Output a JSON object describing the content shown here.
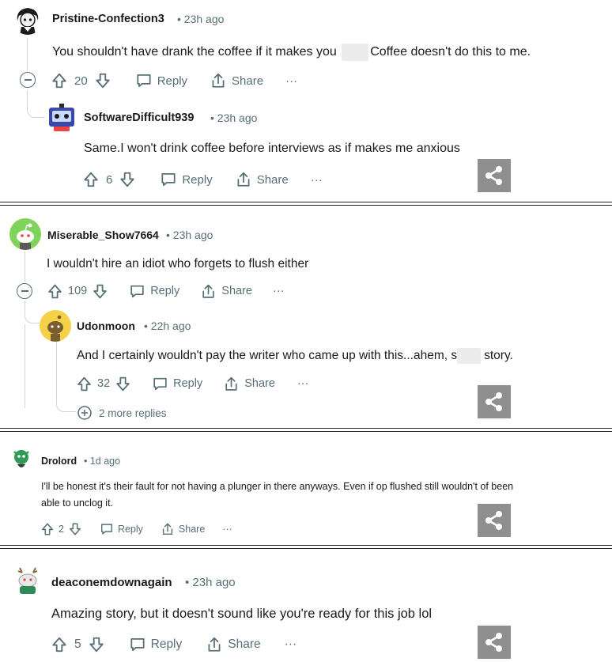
{
  "comments": [
    {
      "username": "Pristine-Confection3",
      "time": "• 23h ago",
      "text_before": "You shouldn't have drank the coffee if it makes you",
      "text_after": "Coffee doesn't do this to me.",
      "votes": "20",
      "reply": "Reply",
      "share": "Share",
      "more": "···",
      "avatar": "black-white-anime-avatar-icon",
      "reply_comment": {
        "username": "SoftwareDifficult939",
        "time": "• 23h ago",
        "text": "Same.I won't drink coffee before interviews as if makes me anxious",
        "votes": "6",
        "reply": "Reply",
        "share": "Share",
        "more": "···",
        "avatar": "robot-avatar-icon"
      }
    },
    {
      "username": "Miserable_Show7664",
      "time": "• 23h ago",
      "text": "I wouldn't hire an idiot who forgets to flush either",
      "votes": "109",
      "reply": "Reply",
      "share": "Share",
      "more": "···",
      "avatar": "green-snoo-avatar-icon",
      "reply_comment": {
        "username": "Udonmoon",
        "time": "• 22h ago",
        "text_before": "And I certainly wouldn't pay the writer who came up with this...ahem, s",
        "text_after": "story.",
        "votes": "32",
        "reply": "Reply",
        "share": "Share",
        "more": "···",
        "avatar": "yellow-snoo-avatar-icon"
      },
      "more_replies": "2 more replies"
    },
    {
      "username": "Drolord",
      "time": "• 1d ago",
      "text_line1": "I'll be honest it's their fault for not having a plunger in there anyways. Even if op flushed still wouldn't of been",
      "text_line2": "able to unclog it.",
      "votes": "2",
      "reply": "Reply",
      "share": "Share",
      "more": "···",
      "avatar": "green-dragon-avatar-icon"
    },
    {
      "username": "deaconemdownagain",
      "time": "• 23h ago",
      "text": "Amazing story, but it doesn't sound like you're ready for this job lol",
      "votes": "5",
      "reply": "Reply",
      "share": "Share",
      "more": "···",
      "avatar": "reindeer-snoo-avatar-icon"
    }
  ],
  "colors": {
    "meta": "#576f76",
    "share_fab": "#8f8f8f",
    "thread_line": "#d0d6d9"
  }
}
